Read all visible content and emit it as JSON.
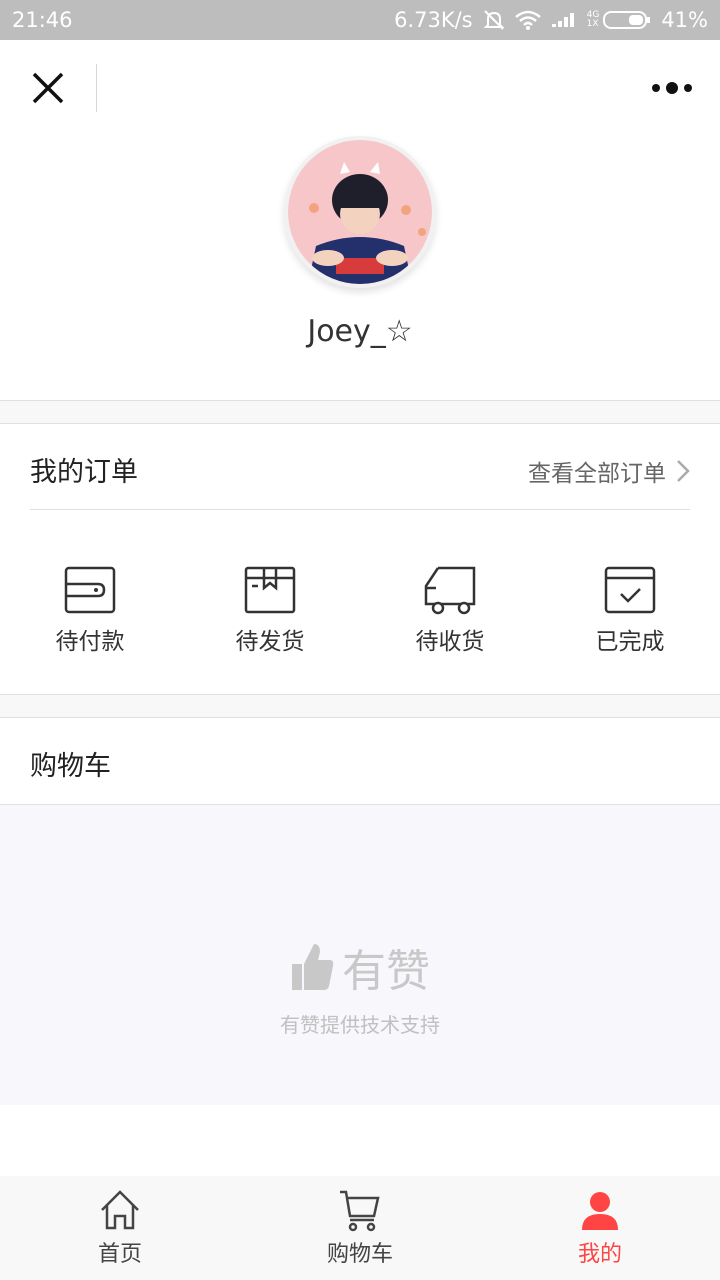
{
  "status_bar": {
    "time": "21:46",
    "speed": "6.73K/s",
    "net_top": "4G",
    "net_bottom": "1X",
    "battery": "41%"
  },
  "profile": {
    "username": "Joey_☆"
  },
  "orders": {
    "title": "我的订单",
    "view_all": "查看全部订单",
    "items": [
      {
        "label": "待付款",
        "icon": "wallet-icon"
      },
      {
        "label": "待发货",
        "icon": "package-icon"
      },
      {
        "label": "待收货",
        "icon": "truck-icon"
      },
      {
        "label": "已完成",
        "icon": "done-box-icon"
      }
    ]
  },
  "cart": {
    "title": "购物车"
  },
  "footer": {
    "brand": "有赞",
    "support": "有赞提供技术支持"
  },
  "tabs": [
    {
      "label": "首页",
      "icon": "home-icon"
    },
    {
      "label": "购物车",
      "icon": "cart-icon"
    },
    {
      "label": "我的",
      "icon": "user-icon"
    }
  ],
  "colors": {
    "accent": "#ff4444",
    "status_bar": "#bdbdbd",
    "background": "#f8f7fb"
  }
}
